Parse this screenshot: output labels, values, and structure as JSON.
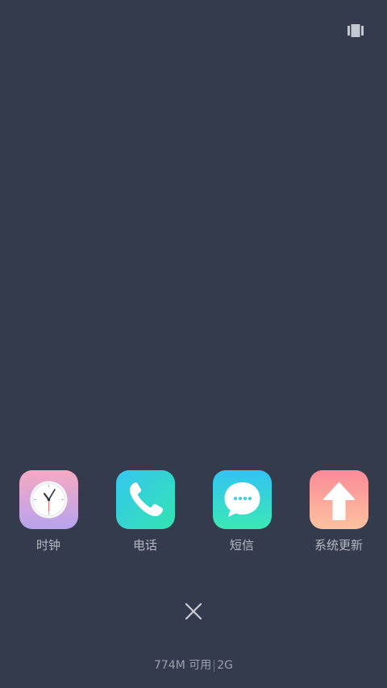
{
  "header": {
    "view_toggle_icon": "card-view-icon"
  },
  "apps": [
    {
      "label": "时钟",
      "icon": "clock-icon",
      "colors": [
        "#f7a9c2",
        "#b7a3ee"
      ]
    },
    {
      "label": "电话",
      "icon": "phone-icon",
      "colors": [
        "#35c7f0",
        "#33e3b1"
      ]
    },
    {
      "label": "短信",
      "icon": "message-icon",
      "colors": [
        "#33c3f3",
        "#3be8b5"
      ]
    },
    {
      "label": "系统更新",
      "icon": "arrow-up-icon",
      "colors": [
        "#fb8b99",
        "#fcc29f"
      ]
    }
  ],
  "footer": {
    "close_icon": "close-icon",
    "available": "774M 可用",
    "total": "2G"
  },
  "colors": {
    "background": "#343b4c",
    "label": "#b4b8c2"
  }
}
